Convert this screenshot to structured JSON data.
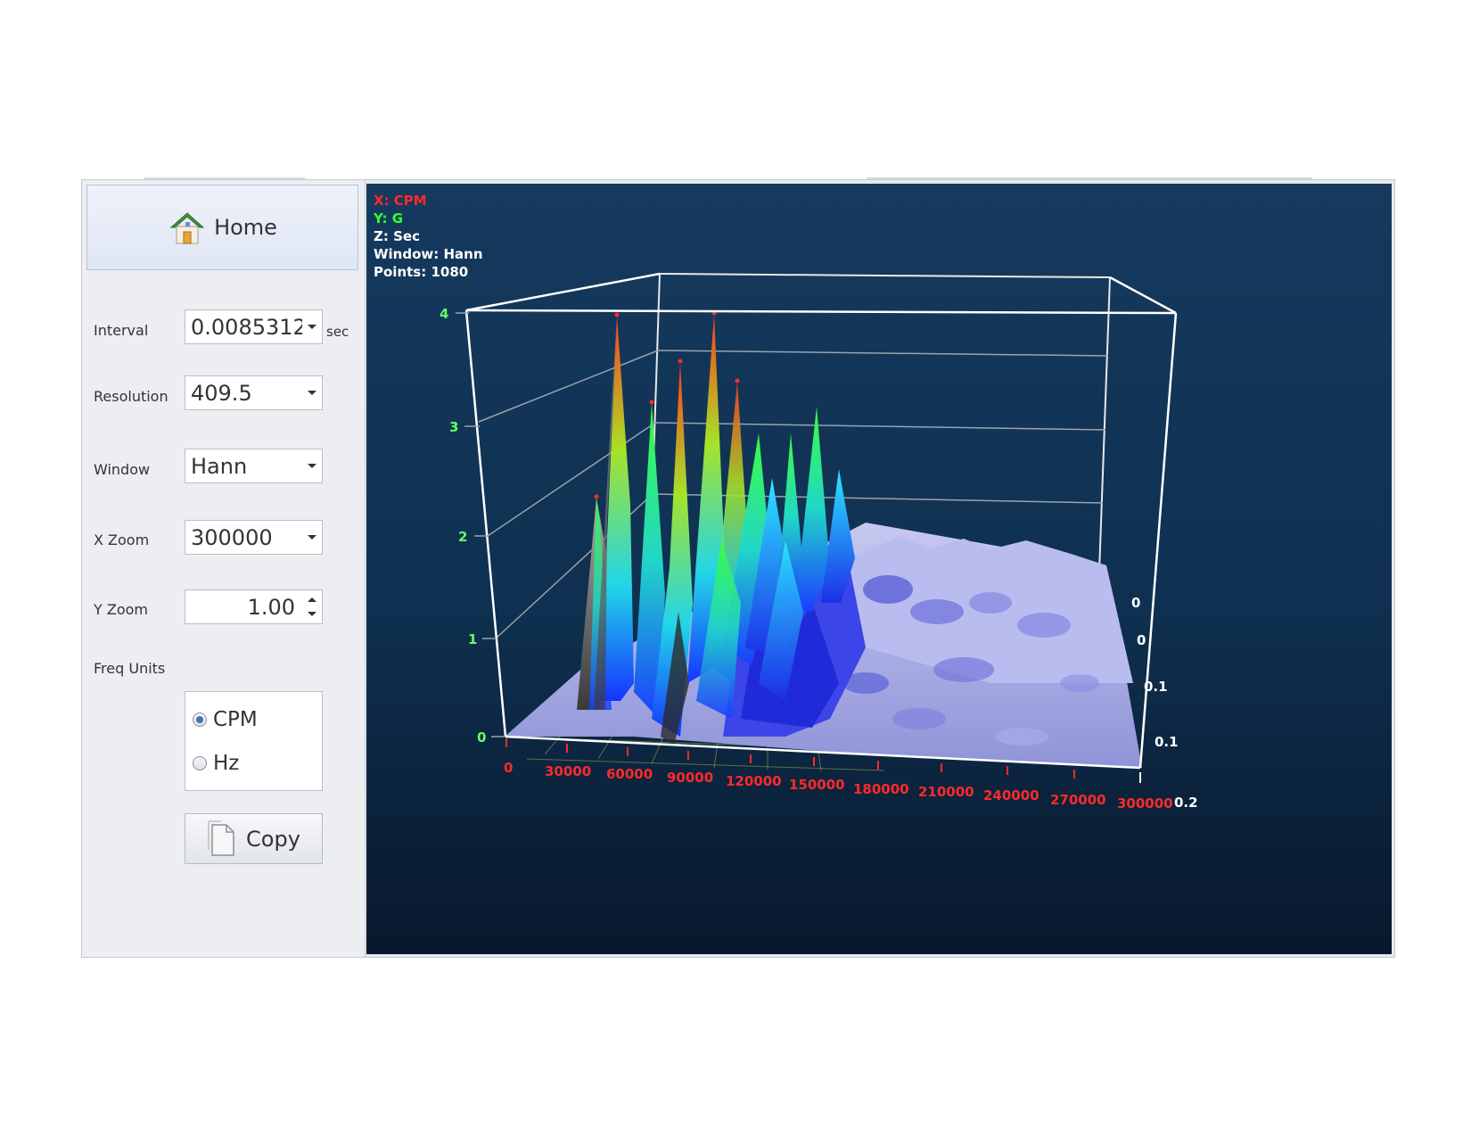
{
  "home_button": {
    "label": "Home",
    "icon": "home-icon"
  },
  "settings": {
    "interval": {
      "label": "Interval",
      "value": "0.0085312",
      "unit": "sec"
    },
    "resolution": {
      "label": "Resolution",
      "value": "409.5"
    },
    "window": {
      "label": "Window",
      "value": "Hann"
    },
    "x_zoom": {
      "label": "X Zoom",
      "value": "300000"
    },
    "y_zoom": {
      "label": "Y Zoom",
      "value": "1.00"
    },
    "freq_units": {
      "label": "Freq Units",
      "options": [
        {
          "label": "CPM",
          "selected": true
        },
        {
          "label": "Hz",
          "selected": false
        }
      ]
    }
  },
  "copy_button": {
    "label": "Copy",
    "icon": "document-icon"
  },
  "plot": {
    "info_lines": [
      {
        "text": "X: CPM",
        "color": "#ff2a2a"
      },
      {
        "text": "Y: G",
        "color": "#33ff33"
      },
      {
        "text": "Z: Sec",
        "color": "#ffffff"
      },
      {
        "text": "Window: Hann",
        "color": "#ffffff"
      },
      {
        "text": "Points: 1080",
        "color": "#ffffff"
      }
    ],
    "x_ticks": [
      "0",
      "30000",
      "60000",
      "90000",
      "120000",
      "150000",
      "180000",
      "210000",
      "240000",
      "270000",
      "300000"
    ],
    "y_ticks": [
      "0",
      "1",
      "2",
      "3",
      "4"
    ],
    "z_ticks": [
      "0",
      "0",
      "0.1",
      "0.1",
      "0.2"
    ],
    "colors": {
      "x_axis": "#ff2a2a",
      "y_axis": "#66ff66",
      "z_axis": "#ffffff",
      "box": "#ffffff"
    }
  }
}
